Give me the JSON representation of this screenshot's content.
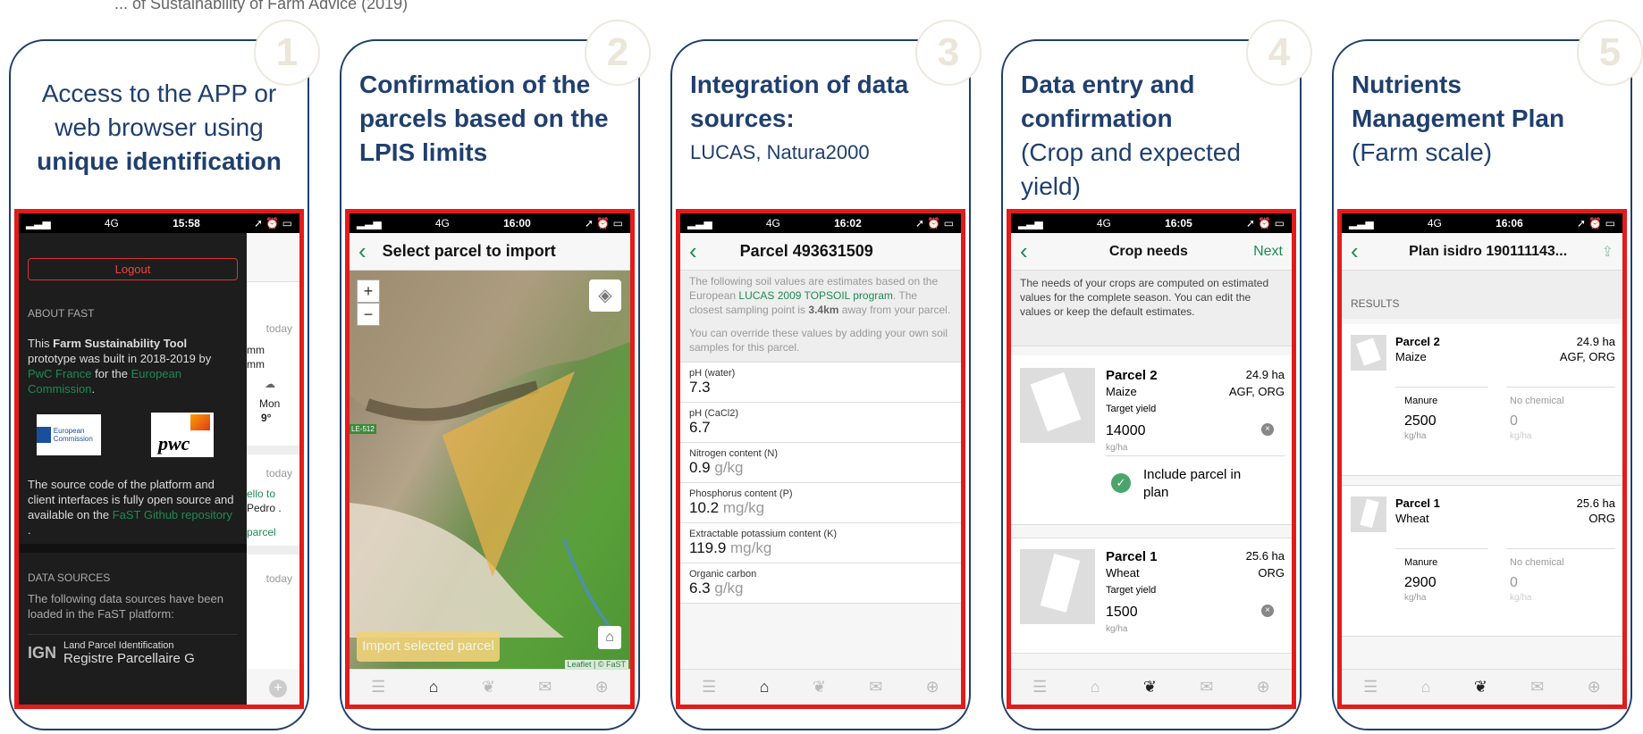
{
  "top_caption": "... of Sustainability of Farm Advice (2019)",
  "cards": [
    {
      "num": "1",
      "title_l1": "Access to the APP or",
      "title_l2": "web browser using",
      "title_bold": "unique identification"
    },
    {
      "num": "2",
      "title": "Confirmation of the parcels based on the LPIS limits"
    },
    {
      "num": "3",
      "title": "Integration of data sources:",
      "subtitle": "LUCAS, Natura2000"
    },
    {
      "num": "4",
      "title": "Data entry and confirmation",
      "subtitle": "(Crop and expected yield)"
    },
    {
      "num": "5",
      "title": "Nutrients Management Plan",
      "subtitle": "(Farm scale)"
    }
  ],
  "s1": {
    "status": {
      "net": "4G",
      "time": "15:58"
    },
    "logout": "Logout",
    "about": "ABOUT FAST",
    "para1_a": "This ",
    "para1_b": "Farm Sustainability Tool",
    "para1_c": " prototype was built in 2018-2019 by ",
    "para1_d": "PwC France",
    "para1_e": " for the ",
    "para1_f": "European Commission",
    "para1_g": ".",
    "para2_a": "The source code of the platform and client interfaces is fully open source and available on the ",
    "para2_b": "FaST Github repository",
    "para2_c": " .",
    "ds": "DATA SOURCES",
    "ds_text": "The following data sources have been loaded in the FaST platform:",
    "ign": "IGN",
    "lpi": "Land Parcel Identification",
    "rpg": "Registre Parcellaire G",
    "pwc": "pwc",
    "ec": "European Commission",
    "bg": {
      "today1": "today",
      "mm1": "mm",
      "mm2": "mm",
      "mon": "Mon",
      "deg": "9°",
      "today2": "today",
      "ello": "ello to",
      "pedro": "Pedro .",
      "parcel": "parcel",
      "today3": "today"
    }
  },
  "s2": {
    "status": {
      "net": "4G",
      "time": "16:00"
    },
    "title": "Select parcel to import",
    "import": "Import selected parcel",
    "attrib": "Leaflet | © FaST",
    "road": "LE-512"
  },
  "s3": {
    "status": {
      "net": "4G",
      "time": "16:02"
    },
    "title": "Parcel 493631509",
    "intro_a": "The following soil values are estimates based on the European ",
    "intro_b": "LUCAS 2009 TOPSOIL program",
    "intro_c": ". The closest sampling point is ",
    "intro_d": "3.4km",
    "intro_e": " away from your parcel.",
    "intro2": "You can override these values by adding your own soil samples for this parcel.",
    "fields": [
      {
        "l": "pH (water)",
        "v": "7.3",
        "u": ""
      },
      {
        "l": "pH (CaCl2)",
        "v": "6.7",
        "u": ""
      },
      {
        "l": "Nitrogen content (N)",
        "v": "0.9",
        "u": "g/kg"
      },
      {
        "l": "Phosphorus content (P)",
        "v": "10.2",
        "u": "mg/kg"
      },
      {
        "l": "Extractable potassium content (K)",
        "v": "119.9",
        "u": "mg/kg"
      },
      {
        "l": "Organic carbon",
        "v": "6.3",
        "u": "g/kg"
      }
    ]
  },
  "s4": {
    "status": {
      "net": "4G",
      "time": "16:05"
    },
    "title": "Crop needs",
    "next": "Next",
    "intro": "The needs of your crops are computed on estimated values for the complete season. You can edit the values or keep the default estimates.",
    "parcels": [
      {
        "name": "Parcel 2",
        "ha": "24.9 ha",
        "crop": "Maize",
        "tags": "AGF, ORG",
        "ty": "Target yield",
        "val": "14000",
        "unit": "kg/ha",
        "inc": "Include parcel in plan"
      },
      {
        "name": "Parcel 1",
        "ha": "25.6 ha",
        "crop": "Wheat",
        "tags": "ORG",
        "ty": "Target yield",
        "val": "1500",
        "unit": "kg/ha"
      }
    ]
  },
  "s5": {
    "status": {
      "net": "4G",
      "time": "16:06"
    },
    "title": "Plan isidro 190111143...",
    "results": "RESULTS",
    "parcels": [
      {
        "name": "Parcel 2",
        "ha": "24.9 ha",
        "crop": "Maize",
        "tags": "AGF, ORG",
        "m": "Manure",
        "mv": "2500",
        "nc": "No chemical",
        "ncv": "0",
        "u": "kg/ha"
      },
      {
        "name": "Parcel 1",
        "ha": "25.6 ha",
        "crop": "Wheat",
        "tags": "ORG",
        "m": "Manure",
        "mv": "2900",
        "nc": "No chemical",
        "ncv": "0",
        "u": "kg/ha"
      }
    ]
  }
}
